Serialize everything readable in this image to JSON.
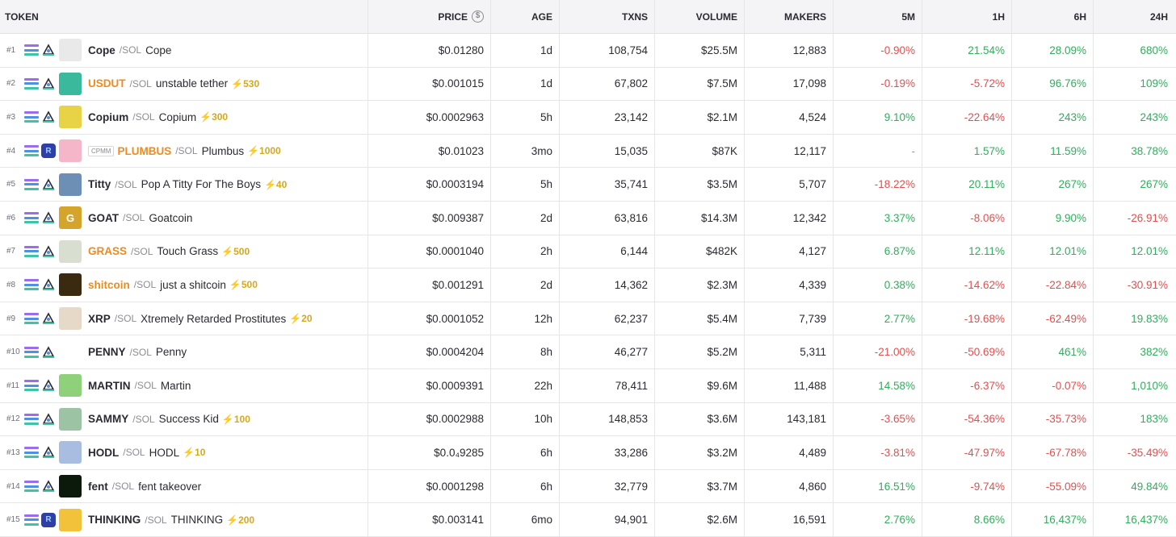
{
  "headers": {
    "token": "TOKEN",
    "price": "PRICE",
    "age": "AGE",
    "txns": "TXNS",
    "volume": "VOLUME",
    "makers": "MAKERS",
    "m5": "5M",
    "h1": "1H",
    "h6": "6H",
    "h24": "24H"
  },
  "price_icon": "$",
  "rows": [
    {
      "rank": "#1",
      "symbol": "Cope",
      "quote": "/SOL",
      "name": "Cope",
      "boost": "",
      "cpmm": "",
      "price": "$0.01280",
      "age": "1d",
      "txns": "108,754",
      "volume": "$25.5M",
      "makers": "12,883",
      "m5": "-0.90%",
      "h1": "21.54%",
      "h6": "28.09%",
      "h24": "680%",
      "sym_color": "",
      "avatar_color": "#e9e9e9",
      "avatar_text": "",
      "dex": "raydium"
    },
    {
      "rank": "#2",
      "symbol": "USDUT",
      "quote": "/SOL",
      "name": "unstable tether",
      "boost": "⚡530",
      "cpmm": "",
      "price": "$0.001015",
      "age": "1d",
      "txns": "67,802",
      "volume": "$7.5M",
      "makers": "17,098",
      "m5": "-0.19%",
      "h1": "-5.72%",
      "h6": "96.76%",
      "h24": "109%",
      "sym_color": "orange",
      "avatar_color": "#3bb99c",
      "avatar_text": "",
      "dex": "raydium"
    },
    {
      "rank": "#3",
      "symbol": "Copium",
      "quote": "/SOL",
      "name": "Copium",
      "boost": "⚡300",
      "cpmm": "",
      "price": "$0.0002963",
      "age": "5h",
      "txns": "23,142",
      "volume": "$2.1M",
      "makers": "4,524",
      "m5": "9.10%",
      "h1": "-22.64%",
      "h6": "243%",
      "h24": "243%",
      "sym_color": "",
      "avatar_color": "#e8d347",
      "avatar_text": "",
      "dex": "raydium"
    },
    {
      "rank": "#4",
      "symbol": "PLUMBUS",
      "quote": "/SOL",
      "name": "Plumbus",
      "boost": "⚡1000",
      "cpmm": "CPMM",
      "price": "$0.01023",
      "age": "3mo",
      "txns": "15,035",
      "volume": "$87K",
      "makers": "12,117",
      "m5": "-",
      "h1": "1.57%",
      "h6": "11.59%",
      "h24": "38.78%",
      "sym_color": "orange",
      "avatar_color": "#f4b6c8",
      "avatar_text": "",
      "dex": "raydium-cpmm"
    },
    {
      "rank": "#5",
      "symbol": "Titty",
      "quote": "/SOL",
      "name": "Pop A Titty For The Boys",
      "boost": "⚡40",
      "cpmm": "",
      "price": "$0.0003194",
      "age": "5h",
      "txns": "35,741",
      "volume": "$3.5M",
      "makers": "5,707",
      "m5": "-18.22%",
      "h1": "20.11%",
      "h6": "267%",
      "h24": "267%",
      "sym_color": "",
      "avatar_color": "#6e8fb5",
      "avatar_text": "",
      "dex": "raydium"
    },
    {
      "rank": "#6",
      "symbol": "GOAT",
      "quote": "/SOL",
      "name": "Goatcoin",
      "boost": "",
      "cpmm": "",
      "price": "$0.009387",
      "age": "2d",
      "txns": "63,816",
      "volume": "$14.3M",
      "makers": "12,342",
      "m5": "3.37%",
      "h1": "-8.06%",
      "h6": "9.90%",
      "h24": "-26.91%",
      "sym_color": "",
      "avatar_color": "#d4a52a",
      "avatar_text": "G",
      "dex": "raydium"
    },
    {
      "rank": "#7",
      "symbol": "GRASS",
      "quote": "/SOL",
      "name": "Touch Grass",
      "boost": "⚡500",
      "cpmm": "",
      "price": "$0.0001040",
      "age": "2h",
      "txns": "6,144",
      "volume": "$482K",
      "makers": "4,127",
      "m5": "6.87%",
      "h1": "12.11%",
      "h6": "12.01%",
      "h24": "12.01%",
      "sym_color": "orange",
      "avatar_color": "#d9dfd0",
      "avatar_text": "",
      "dex": "raydium"
    },
    {
      "rank": "#8",
      "symbol": "shitcoin",
      "quote": "/SOL",
      "name": "just a shitcoin",
      "boost": "⚡500",
      "cpmm": "",
      "price": "$0.001291",
      "age": "2d",
      "txns": "14,362",
      "volume": "$2.3M",
      "makers": "4,339",
      "m5": "0.38%",
      "h1": "-14.62%",
      "h6": "-22.84%",
      "h24": "-30.91%",
      "sym_color": "orange",
      "avatar_color": "#3a2a10",
      "avatar_text": "",
      "dex": "raydium"
    },
    {
      "rank": "#9",
      "symbol": "XRP",
      "quote": "/SOL",
      "name": "Xtremely Retarded Prostitutes",
      "boost": "⚡20",
      "cpmm": "",
      "price": "$0.0001052",
      "age": "12h",
      "txns": "62,237",
      "volume": "$5.4M",
      "makers": "7,739",
      "m5": "2.77%",
      "h1": "-19.68%",
      "h6": "-62.49%",
      "h24": "19.83%",
      "sym_color": "",
      "avatar_color": "#e6d9c8",
      "avatar_text": "",
      "dex": "raydium"
    },
    {
      "rank": "#10",
      "symbol": "PENNY",
      "quote": "/SOL",
      "name": "Penny",
      "boost": "",
      "cpmm": "",
      "price": "$0.0004204",
      "age": "8h",
      "txns": "46,277",
      "volume": "$5.2M",
      "makers": "5,311",
      "m5": "-21.00%",
      "h1": "-50.69%",
      "h6": "461%",
      "h24": "382%",
      "sym_color": "",
      "avatar_color": "#ffffff",
      "avatar_text": "",
      "dex": "raydium"
    },
    {
      "rank": "#11",
      "symbol": "MARTIN",
      "quote": "/SOL",
      "name": "Martin",
      "boost": "",
      "cpmm": "",
      "price": "$0.0009391",
      "age": "22h",
      "txns": "78,411",
      "volume": "$9.6M",
      "makers": "11,488",
      "m5": "14.58%",
      "h1": "-6.37%",
      "h6": "-0.07%",
      "h24": "1,010%",
      "sym_color": "",
      "avatar_color": "#8fd17a",
      "avatar_text": "",
      "dex": "raydium"
    },
    {
      "rank": "#12",
      "symbol": "SAMMY",
      "quote": "/SOL",
      "name": "Success Kid",
      "boost": "⚡100",
      "cpmm": "",
      "price": "$0.0002988",
      "age": "10h",
      "txns": "148,853",
      "volume": "$3.6M",
      "makers": "143,181",
      "m5": "-3.65%",
      "h1": "-54.36%",
      "h6": "-35.73%",
      "h24": "183%",
      "sym_color": "",
      "avatar_color": "#9cc3a3",
      "avatar_text": "",
      "dex": "raydium"
    },
    {
      "rank": "#13",
      "symbol": "HODL",
      "quote": "/SOL",
      "name": "HODL",
      "boost": "⚡10",
      "cpmm": "",
      "price": "$0.0₄9285",
      "age": "6h",
      "txns": "33,286",
      "volume": "$3.2M",
      "makers": "4,489",
      "m5": "-3.81%",
      "h1": "-47.97%",
      "h6": "-67.78%",
      "h24": "-35.49%",
      "sym_color": "",
      "avatar_color": "#a9bde0",
      "avatar_text": "",
      "dex": "raydium"
    },
    {
      "rank": "#14",
      "symbol": "fent",
      "quote": "/SOL",
      "name": "fent takeover",
      "boost": "",
      "cpmm": "",
      "price": "$0.0001298",
      "age": "6h",
      "txns": "32,779",
      "volume": "$3.7M",
      "makers": "4,860",
      "m5": "16.51%",
      "h1": "-9.74%",
      "h6": "-55.09%",
      "h24": "49.84%",
      "sym_color": "",
      "avatar_color": "#0c1a0c",
      "avatar_text": "",
      "dex": "raydium"
    },
    {
      "rank": "#15",
      "symbol": "THINKING",
      "quote": "/SOL",
      "name": "THINKING",
      "boost": "⚡200",
      "cpmm": "",
      "price": "$0.003141",
      "age": "6mo",
      "txns": "94,901",
      "volume": "$2.6M",
      "makers": "16,591",
      "m5": "2.76%",
      "h1": "8.66%",
      "h6": "16,437%",
      "h24": "16,437%",
      "sym_color": "",
      "avatar_color": "#f2c23a",
      "avatar_text": "",
      "dex": "raydium-cpmm"
    }
  ]
}
